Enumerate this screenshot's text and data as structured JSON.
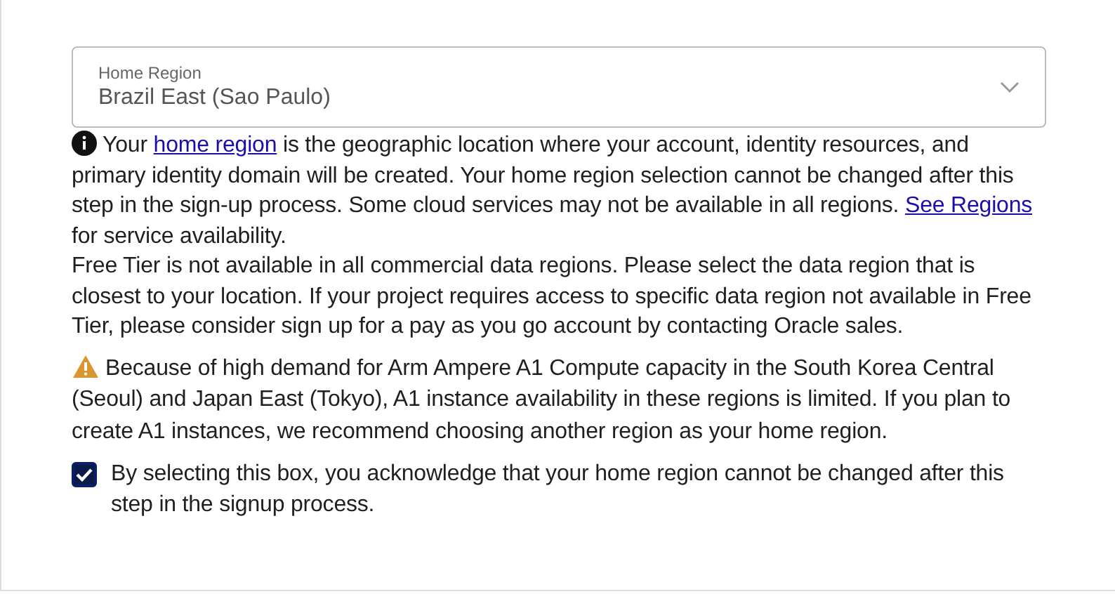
{
  "region_select": {
    "label": "Home Region",
    "value": "Brazil East (Sao Paulo)"
  },
  "info": {
    "segments": [
      {
        "text": "Your ",
        "kind": "text"
      },
      {
        "text": "home region",
        "kind": "link"
      },
      {
        "text": " is the geographic location where your account, identity resources, and primary identity domain will be created. Your home region selection cannot be changed after this step in the sign-up process. Some cloud services may not be available in all regions. ",
        "kind": "text"
      },
      {
        "text": "See Regions",
        "kind": "link"
      },
      {
        "text": " for service availability.",
        "kind": "text"
      }
    ],
    "note": "Free Tier is not available in all commercial data regions. Please select the data region that is closest to your location. If your project requires access to specific data region not available in Free Tier, please consider sign up for a pay as you go account by contacting Oracle sales."
  },
  "warning": "Because of high demand for Arm Ampere A1 Compute capacity in the South Korea Central (Seoul) and Japan East (Tokyo), A1 instance availability in these regions is limited. If you plan to create A1 instances, we recommend choosing another region as your home region.",
  "acknowledge": {
    "label": "By selecting this box, you acknowledge that your home region cannot be changed after this step in the signup process.",
    "checked": true
  }
}
